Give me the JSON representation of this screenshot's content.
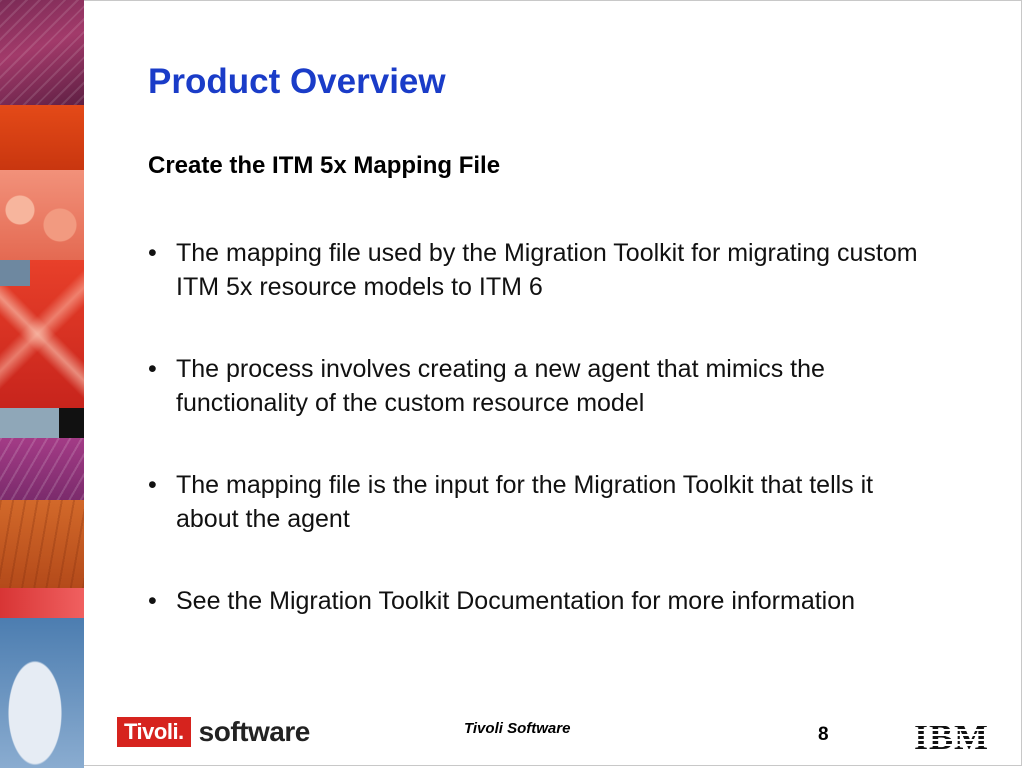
{
  "slide": {
    "title": "Product Overview",
    "subtitle": "Create the ITM 5x Mapping File",
    "bullets": [
      "The mapping file used by the Migration Toolkit for migrating custom ITM 5x resource models to ITM 6",
      "The process involves creating a new agent that mimics the functionality of the custom resource model",
      "The mapping file is the input for the Migration Toolkit that tells it about the agent",
      "See the Migration Toolkit Documentation for more information"
    ],
    "bullet_glyph": "•"
  },
  "footer": {
    "logo_brand": "Tivoli.",
    "logo_suffix": "software",
    "center_text": "Tivoli Software",
    "page_number": "8",
    "corp_logo": "IBM"
  },
  "colors": {
    "title": "#1a3cc8",
    "brand_red": "#d6231e"
  }
}
